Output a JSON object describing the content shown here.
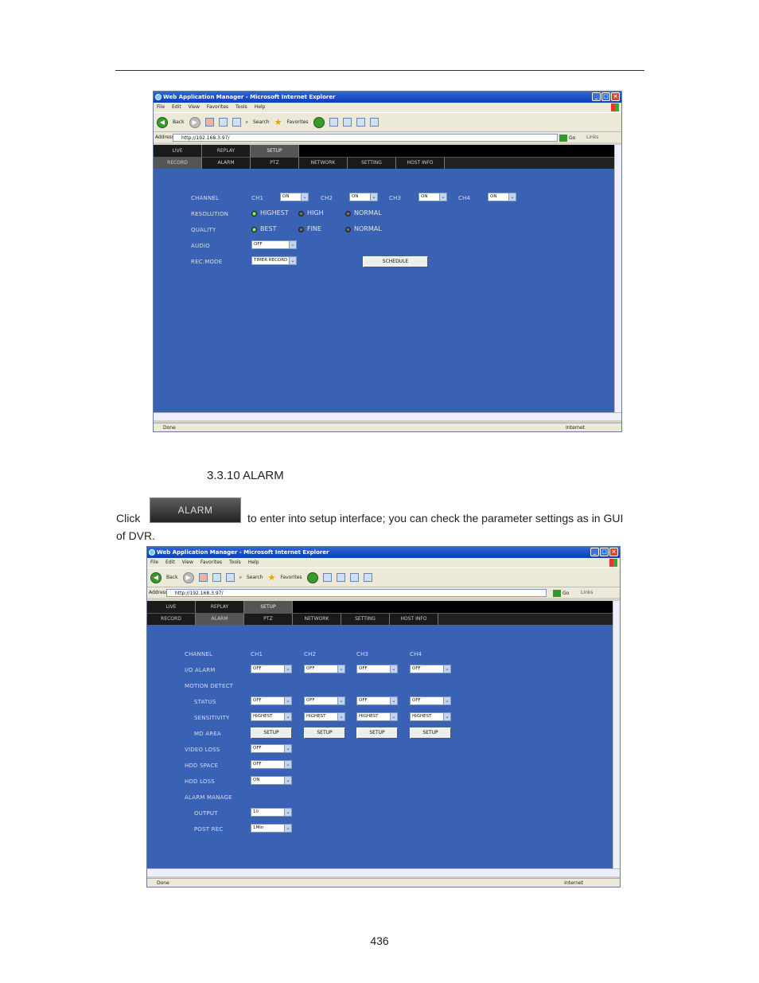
{
  "browser": {
    "title": "Web Application Manager - Microsoft Internet Explorer",
    "menu": [
      "File",
      "Edit",
      "View",
      "Favorites",
      "Tools",
      "Help"
    ],
    "toolbar": {
      "back": "Back",
      "search": "Search",
      "favorites": "Favorites"
    },
    "address_label": "Address",
    "address": "http://192.168.3.97/",
    "go": "Go",
    "links": "Links",
    "status": "Done",
    "zone": "Internet"
  },
  "topnav": [
    "LIVE",
    "REPLAY",
    "SETUP"
  ],
  "subnav": [
    "RECORD",
    "ALARM",
    "PTZ",
    "NETWORK",
    "SETTING",
    "HOST INFO"
  ],
  "record": {
    "channel_label": "CHANNEL",
    "channels": [
      {
        "name": "CH1",
        "value": "ON"
      },
      {
        "name": "CH2",
        "value": "ON"
      },
      {
        "name": "CH3",
        "value": "ON"
      },
      {
        "name": "CH4",
        "value": "ON"
      }
    ],
    "resolution_label": "RESOLUTION",
    "resolution_options": [
      "HIGHEST",
      "HIGH",
      "NORMAL"
    ],
    "resolution_selected": "HIGHEST",
    "quality_label": "QUALITY",
    "quality_options": [
      "BEST",
      "FINE",
      "NORMAL"
    ],
    "quality_selected": "BEST",
    "audio_label": "AUDIO",
    "audio_value": "OFF",
    "recmode_label": "REC.MODE",
    "recmode_value": "TIMER RECORD",
    "schedule_button": "SCHEDULE"
  },
  "section": {
    "heading": "3.3.10 ALARM",
    "click_text": "Click",
    "button_label": "ALARM",
    "after_text": "to enter into setup interface; you can check the parameter settings as in GUI",
    "line2": "of DVR."
  },
  "alarm": {
    "channel_label": "CHANNEL",
    "channels": [
      "CH1",
      "CH2",
      "CH3",
      "CH4"
    ],
    "io_alarm_label": "I/O ALARM",
    "io_alarm": [
      "OFF",
      "OFF",
      "OFF",
      "OFF"
    ],
    "motion_detect_label": "MOTION DETECT",
    "status_label": "STATUS",
    "status": [
      "OFF",
      "OFF",
      "OFF",
      "OFF"
    ],
    "sensitivity_label": "SENSITIVITY",
    "sensitivity": [
      "HIGHEST",
      "HIGHEST",
      "HIGHEST",
      "HIGHEST"
    ],
    "md_area_label": "MD AREA",
    "md_area_button": "SETUP",
    "video_loss_label": "VIDEO LOSS",
    "video_loss": "OFF",
    "hdd_space_label": "HDD SPACE",
    "hdd_space": "OFF",
    "hdd_loss_label": "HDD LOSS",
    "hdd_loss": "ON",
    "alarm_manage_label": "ALARM MANAGE",
    "output_label": "OUTPUT",
    "output": "10",
    "post_rec_label": "POST REC",
    "post_rec": "1Min"
  },
  "page_number": "436"
}
